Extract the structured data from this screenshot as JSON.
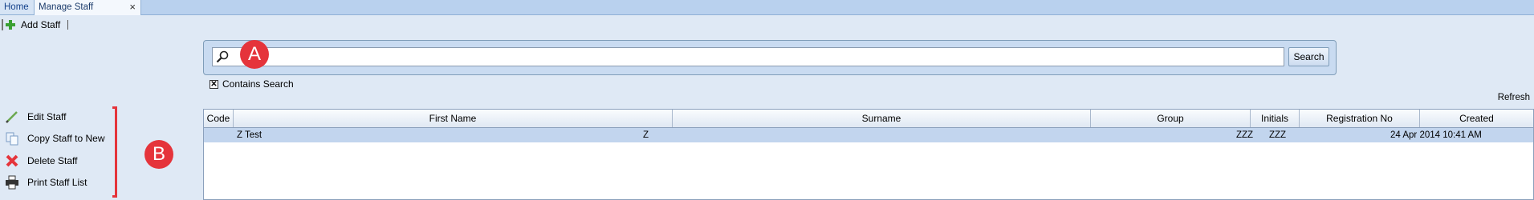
{
  "tabs": [
    {
      "label": "Home"
    },
    {
      "label": "Manage Staff",
      "close": "×"
    }
  ],
  "toolbar": {
    "add_staff_label": "Add Staff"
  },
  "search": {
    "value": "",
    "placeholder": "",
    "button_label": "Search"
  },
  "contains_search": {
    "label": "Contains Search",
    "checked": true,
    "mark": "✕"
  },
  "refresh_label": "Refresh",
  "actions": [
    {
      "label": "Edit Staff",
      "icon": "pencil-icon"
    },
    {
      "label": "Copy Staff to New",
      "icon": "copy-icon"
    },
    {
      "label": "Delete Staff",
      "icon": "delete-x-icon"
    },
    {
      "label": "Print Staff List",
      "icon": "printer-icon"
    }
  ],
  "annotations": {
    "a": "A",
    "b": "B"
  },
  "grid": {
    "columns": [
      "Code",
      "First Name",
      "Surname",
      "Group",
      "Initials",
      "Registration No",
      "Created"
    ],
    "rows": [
      {
        "code": "",
        "first_name": "Z Test",
        "surname": "Z",
        "group": "",
        "initials": "ZZZ",
        "registration_no": "ZZZ",
        "created": "24 Apr 2014  10:41 AM",
        "selected": true
      }
    ]
  },
  "colors": {
    "accent_red": "#e5343b",
    "selected_row": "#c2d5ee",
    "background": "#dfe9f5"
  }
}
